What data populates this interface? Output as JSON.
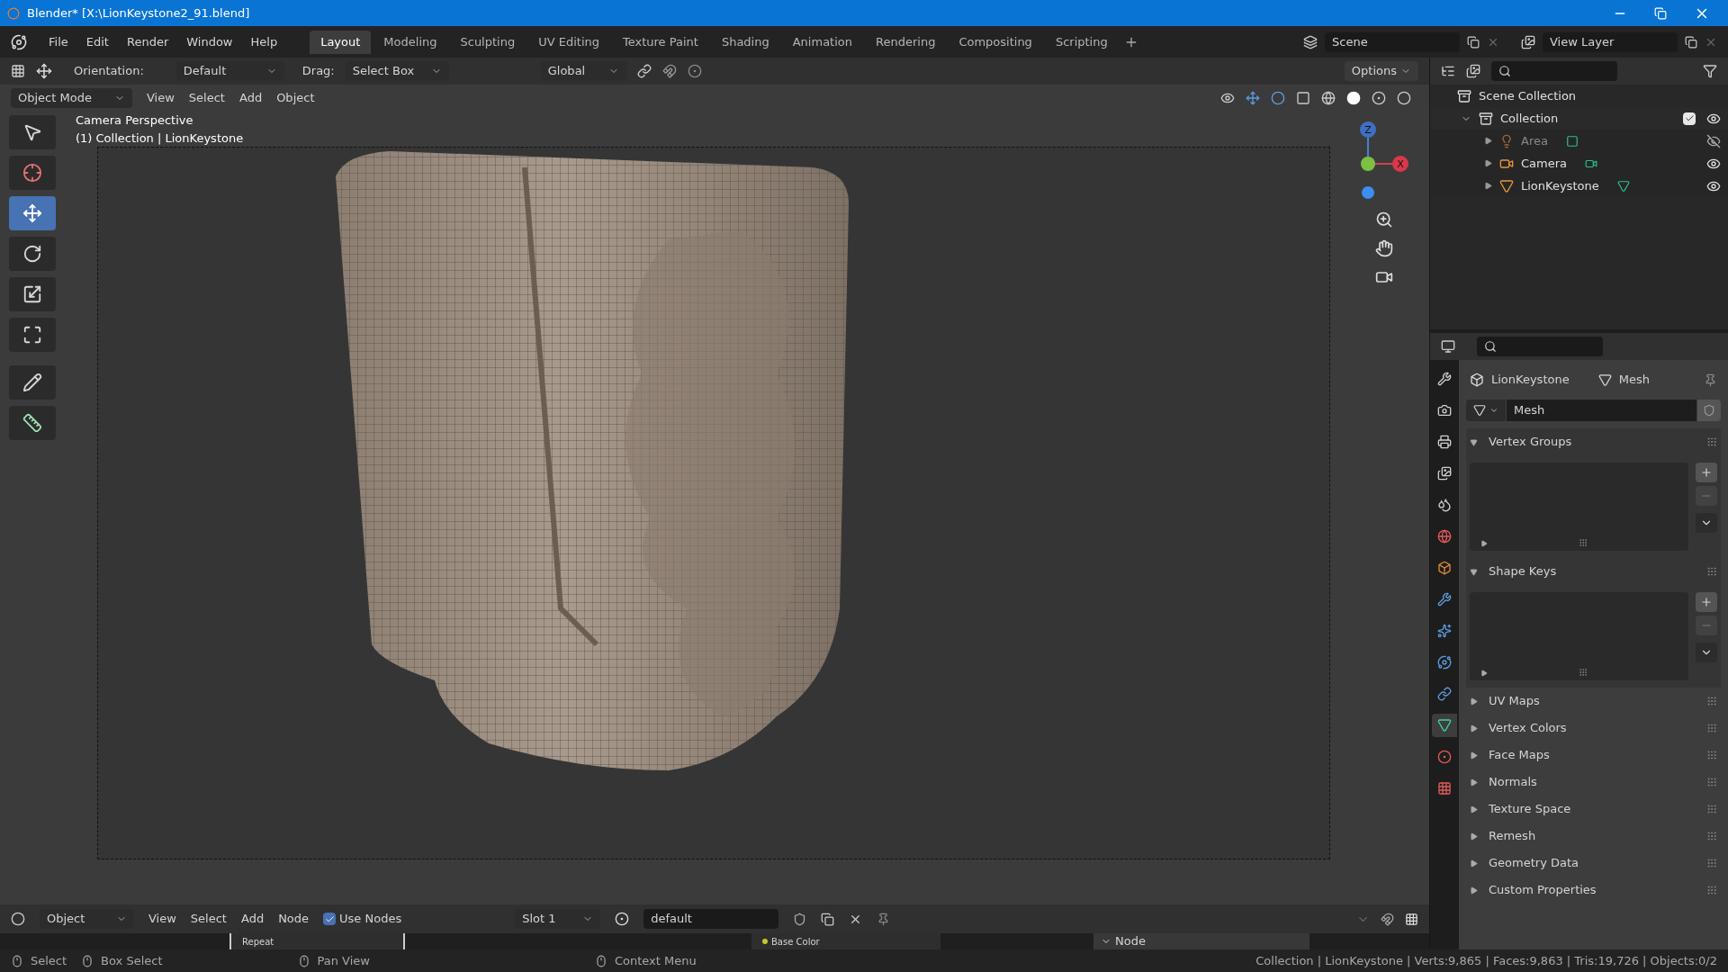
{
  "window": {
    "title": "Blender* [X:\\LionKeystone2_91.blend]"
  },
  "menu": [
    "File",
    "Edit",
    "Render",
    "Window",
    "Help"
  ],
  "workspace_tabs": [
    {
      "label": "Layout",
      "selected": true
    },
    {
      "label": "Modeling",
      "selected": false
    },
    {
      "label": "Sculpting",
      "selected": false
    },
    {
      "label": "UV Editing",
      "selected": false
    },
    {
      "label": "Texture Paint",
      "selected": false
    },
    {
      "label": "Shading",
      "selected": false
    },
    {
      "label": "Animation",
      "selected": false
    },
    {
      "label": "Rendering",
      "selected": false
    },
    {
      "label": "Compositing",
      "selected": false
    },
    {
      "label": "Scripting",
      "selected": false
    }
  ],
  "scene": "Scene",
  "view_layer": "View Layer",
  "tool_header": {
    "orientation_label": "Orientation:",
    "orientation": "Default",
    "drag_label": "Drag:",
    "drag": "Select Box",
    "transform": "Global",
    "options": "Options"
  },
  "viewport_header": {
    "mode": "Object Mode",
    "menus": [
      "View",
      "Select",
      "Add",
      "Object"
    ]
  },
  "viewport": {
    "lines": [
      "Camera Perspective",
      "(1) Collection | LionKeystone"
    ],
    "gizmo": {
      "z": "Z",
      "x": "X"
    }
  },
  "tools": [
    {
      "kind": "select_box",
      "selected": false
    },
    {
      "kind": "cursor",
      "selected": false
    },
    {
      "kind": "move",
      "selected": true
    },
    {
      "kind": "rotate",
      "selected": false
    },
    {
      "kind": "scale",
      "selected": false
    },
    {
      "kind": "transform",
      "selected": false
    },
    {
      "kind": "annotate",
      "selected": false
    },
    {
      "kind": "measure",
      "selected": false
    }
  ],
  "outliner": {
    "root": "Scene Collection",
    "children": [
      {
        "name": "Collection",
        "kind": "collection",
        "expanded": true,
        "checked": true,
        "visible": true,
        "children": [
          {
            "name": "Area",
            "kind": "light",
            "visible": false
          },
          {
            "name": "Camera",
            "kind": "camera",
            "visible": true
          },
          {
            "name": "LionKeystone",
            "kind": "mesh",
            "visible": true
          }
        ]
      }
    ]
  },
  "properties": {
    "breadcrumb": [
      "LionKeystone",
      "Mesh"
    ],
    "datablock": "Mesh",
    "tabs": [
      {
        "kind": "tool",
        "selected": false
      },
      {
        "kind": "render",
        "selected": false
      },
      {
        "kind": "output",
        "selected": false
      },
      {
        "kind": "view_layer",
        "selected": false
      },
      {
        "kind": "scene",
        "selected": false
      },
      {
        "kind": "world",
        "selected": false
      },
      {
        "kind": "object",
        "selected": false
      },
      {
        "kind": "modifiers",
        "selected": false
      },
      {
        "kind": "particles",
        "selected": false
      },
      {
        "kind": "physics",
        "selected": false
      },
      {
        "kind": "constraints",
        "selected": false
      },
      {
        "kind": "data",
        "selected": true
      },
      {
        "kind": "material",
        "selected": false
      },
      {
        "kind": "texture",
        "selected": false
      }
    ],
    "panels": [
      {
        "title": "Vertex Groups",
        "expanded": true
      },
      {
        "title": "Shape Keys",
        "expanded": true
      },
      {
        "title": "UV Maps",
        "expanded": false
      },
      {
        "title": "Vertex Colors",
        "expanded": false
      },
      {
        "title": "Face Maps",
        "expanded": false
      },
      {
        "title": "Normals",
        "expanded": false
      },
      {
        "title": "Texture Space",
        "expanded": false
      },
      {
        "title": "Remesh",
        "expanded": false
      },
      {
        "title": "Geometry Data",
        "expanded": false
      },
      {
        "title": "Custom Properties",
        "expanded": false
      }
    ]
  },
  "node_editor": {
    "editor": "Object",
    "menus": [
      "View",
      "Select",
      "Add",
      "Node"
    ],
    "use_nodes": {
      "label": "Use Nodes",
      "checked": true
    },
    "slot": "Slot 1",
    "material": "default",
    "strip": {
      "dropdown": "Repeat",
      "socket": "Base Color",
      "panel": "Node"
    }
  },
  "status_bar": {
    "hints": [
      "Select",
      "Box Select",
      "Pan View",
      "Context Menu"
    ],
    "stats": "Collection | LionKeystone | Verts:9,865 | Faces:9,863 | Tris:19,726 | Objects:0/2"
  }
}
